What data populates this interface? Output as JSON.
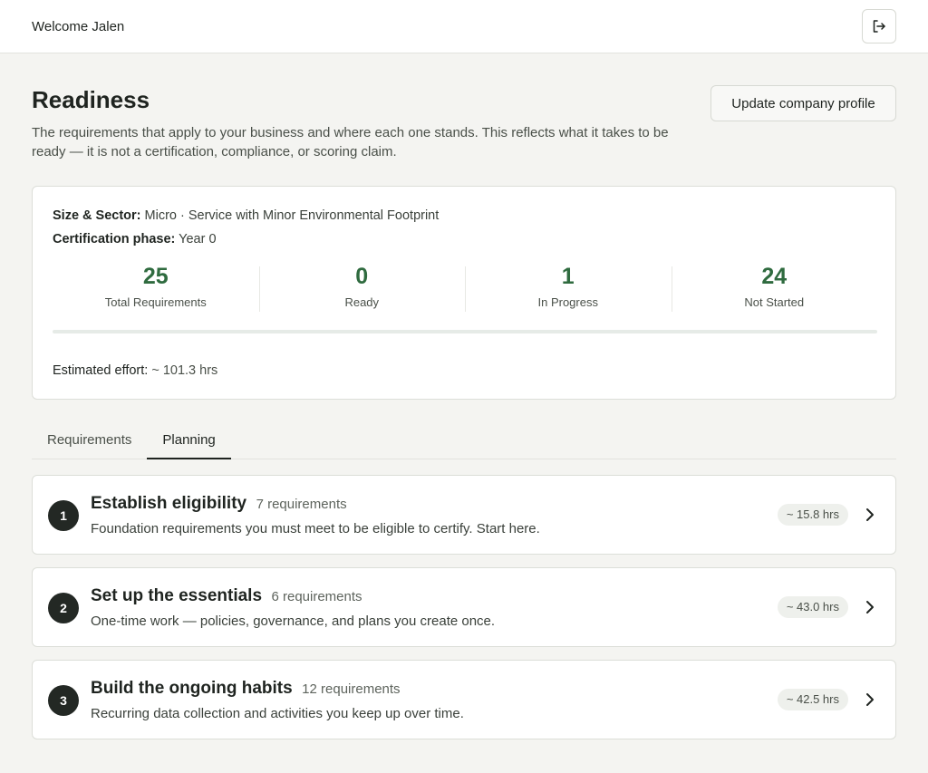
{
  "header": {
    "welcome": "Welcome Jalen",
    "logout_icon": "logout-icon"
  },
  "page": {
    "title": "Readiness",
    "intro": "The requirements that apply to your business and where each one stands. This reflects what it takes to be ready — it is not a certification, compliance, or scoring claim.",
    "update_button": "Update company profile"
  },
  "summary": {
    "size_sector_label": "Size & Sector:",
    "size_sector_value": "Micro · Service with Minor Environmental Footprint",
    "phase_label": "Certification phase:",
    "phase_value": "Year 0",
    "stats": [
      {
        "value": "25",
        "label": "Total Requirements"
      },
      {
        "value": "0",
        "label": "Ready"
      },
      {
        "value": "1",
        "label": "In Progress"
      },
      {
        "value": "24",
        "label": "Not Started"
      }
    ],
    "progress_fraction": 0,
    "effort_label": "Estimated effort:",
    "effort_value": "~ 101.3 hrs"
  },
  "tabs": [
    {
      "label": "Requirements",
      "active": false
    },
    {
      "label": "Planning",
      "active": true
    }
  ],
  "phases": [
    {
      "number": "1",
      "title": "Establish eligibility",
      "count": "7 requirements",
      "description": "Foundation requirements you must meet to be eligible to certify. Start here.",
      "hours": "~ 15.8 hrs"
    },
    {
      "number": "2",
      "title": "Set up the essentials",
      "count": "6 requirements",
      "description": "One-time work — policies, governance, and plans you create once.",
      "hours": "~ 43.0 hrs"
    },
    {
      "number": "3",
      "title": "Build the ongoing habits",
      "count": "12 requirements",
      "description": "Recurring data collection and activities you keep up over time.",
      "hours": "~ 42.5 hrs"
    }
  ],
  "colors": {
    "accent": "#2f6b3f",
    "badge_bg": "#eef0ec",
    "number_bg": "#232824"
  }
}
